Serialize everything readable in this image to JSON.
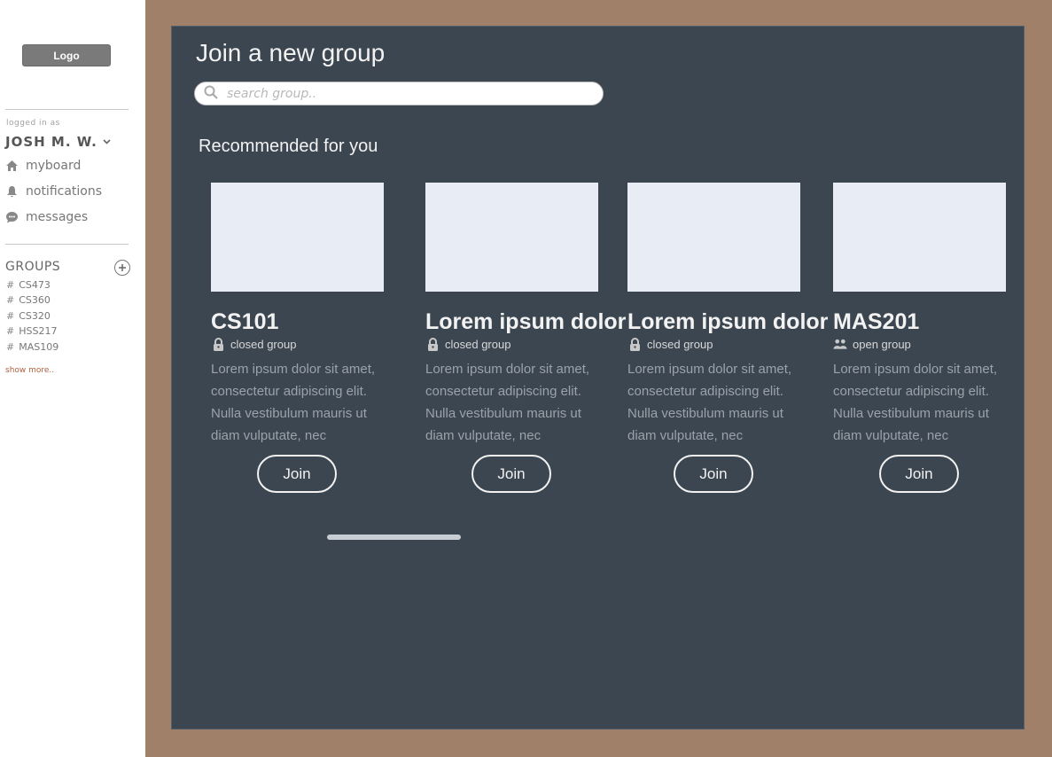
{
  "sidebar": {
    "logo_label": "Logo",
    "logged_in_label": "logged in as",
    "user_name": "JOSH M. W.",
    "nav": [
      {
        "label": "myboard",
        "icon": "home-icon"
      },
      {
        "label": "notifications",
        "icon": "bell-icon"
      },
      {
        "label": "messages",
        "icon": "chat-icon"
      }
    ],
    "groups_title": "GROUPS",
    "groups": [
      "CS473",
      "CS360",
      "CS320",
      "HSS217",
      "MAS109"
    ],
    "show_more": "show more.."
  },
  "main": {
    "title": "Join a new group",
    "search_placeholder": "search group..",
    "section_title": "Recommended for you",
    "cards": [
      {
        "name": "CS101",
        "privacy": "closed group",
        "privacy_icon": "lock-icon",
        "description": "Lorem ipsum dolor sit amet, consectetur adipiscing elit. Nulla vestibulum mauris ut diam vulputate, nec",
        "join_label": "Join"
      },
      {
        "name": "Lorem ipsum dolor",
        "privacy": "closed group",
        "privacy_icon": "lock-icon",
        "description": "Lorem ipsum dolor sit amet, consectetur adipiscing elit. Nulla vestibulum mauris ut diam vulputate, nec",
        "join_label": "Join"
      },
      {
        "name": "Lorem ipsum dolor",
        "privacy": "closed group",
        "privacy_icon": "lock-icon",
        "description": "Lorem ipsum dolor sit amet, consectetur adipiscing elit. Nulla vestibulum mauris ut diam vulputate, nec",
        "join_label": "Join"
      },
      {
        "name": "MAS201",
        "privacy": "open group",
        "privacy_icon": "users-icon",
        "description": "Lorem ipsum dolor sit amet, consectetur adipiscing elit. Nulla vestibulum mauris ut diam vulputate, nec",
        "join_label": "Join"
      }
    ]
  },
  "colors": {
    "background": "#a08068",
    "panel": "#3c4650",
    "thumb": "#e8ecf5",
    "sidebar": "#ffffff"
  }
}
